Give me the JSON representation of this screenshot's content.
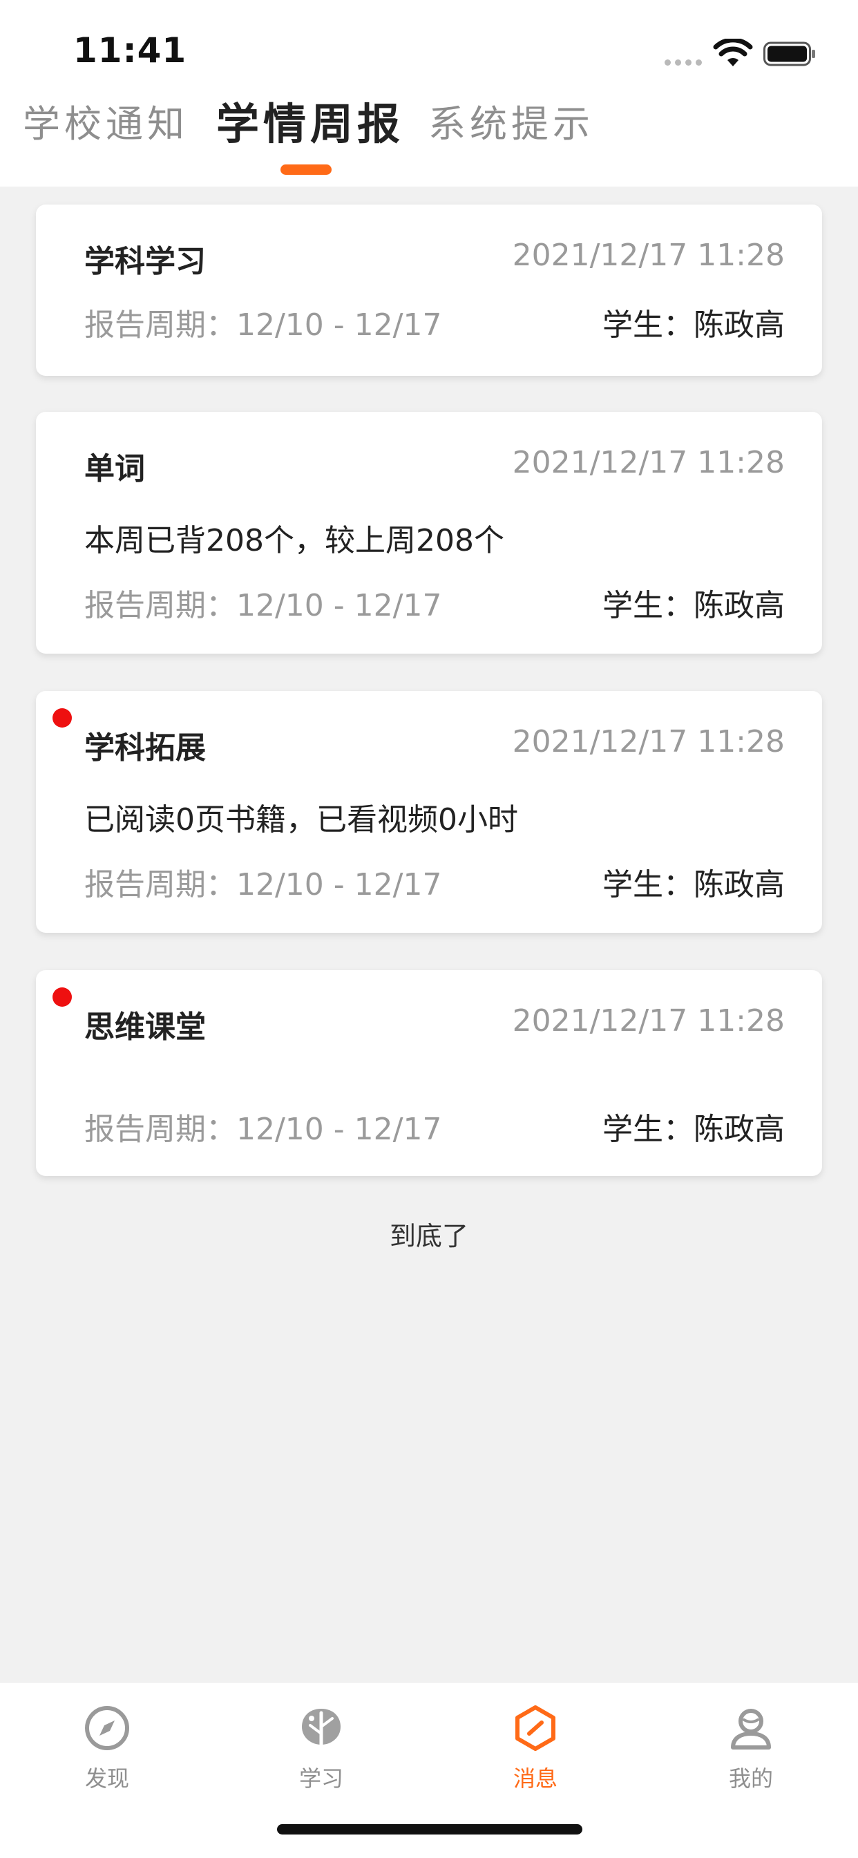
{
  "status_bar": {
    "time": "11:41"
  },
  "tabs": [
    {
      "label": "学校通知",
      "active": false
    },
    {
      "label": "学情周报",
      "active": true
    },
    {
      "label": "系统提示",
      "active": false
    }
  ],
  "cards": [
    {
      "title": "学科学习",
      "time": "2021/12/17 11:28",
      "description": "",
      "period": "报告周期：12/10 - 12/17",
      "student": "学生：陈政高",
      "unread": false
    },
    {
      "title": "单词",
      "time": "2021/12/17 11:28",
      "description": "本周已背208个，较上周208个",
      "period": "报告周期：12/10 - 12/17",
      "student": "学生：陈政高",
      "unread": false
    },
    {
      "title": "学科拓展",
      "time": "2021/12/17 11:28",
      "description": "已阅读0页书籍，已看视频0小时",
      "period": "报告周期：12/10 - 12/17",
      "student": "学生：陈政高",
      "unread": true
    },
    {
      "title": "思维课堂",
      "time": "2021/12/17 11:28",
      "description": "",
      "period": "报告周期：12/10 - 12/17",
      "student": "学生：陈政高",
      "unread": true
    }
  ],
  "footer_text": "到底了",
  "bottom_nav": [
    {
      "label": "发现",
      "icon": "compass-icon",
      "active": false
    },
    {
      "label": "学习",
      "icon": "leaf-icon",
      "active": false
    },
    {
      "label": "消息",
      "icon": "message-icon",
      "active": true
    },
    {
      "label": "我的",
      "icon": "user-icon",
      "active": false
    }
  ],
  "colors": {
    "accent": "#ff6a17",
    "unread_dot": "#ee1010",
    "page_background": "#f1f1f1",
    "muted_text": "#9a9a9a"
  }
}
